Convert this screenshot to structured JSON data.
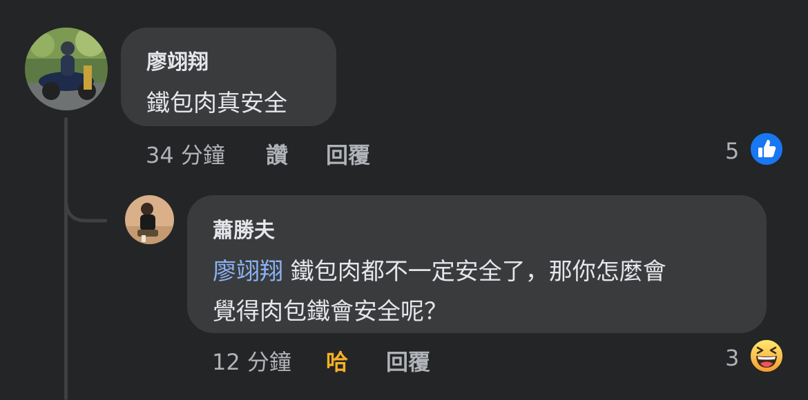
{
  "comments": [
    {
      "author": "廖翊翔",
      "text": "鐵包肉真安全",
      "time": "34 分鐘",
      "like_label": "讚",
      "reply_label": "回覆",
      "reaction_count": "5",
      "reaction_icon": "like-icon",
      "reaction_color": "#1877f2"
    },
    {
      "author": "蕭勝夫",
      "mention": "廖翊翔",
      "text_line1": " 鐵包肉都不一定安全了，那你怎麼會",
      "text_line2": "覺得肉包鐵會安全呢？",
      "time": "12 分鐘",
      "reaction_label": "哈",
      "reply_label": "回覆",
      "reaction_count": "3",
      "reaction_icon": "haha-icon",
      "reaction_color": "#f7b125"
    }
  ]
}
